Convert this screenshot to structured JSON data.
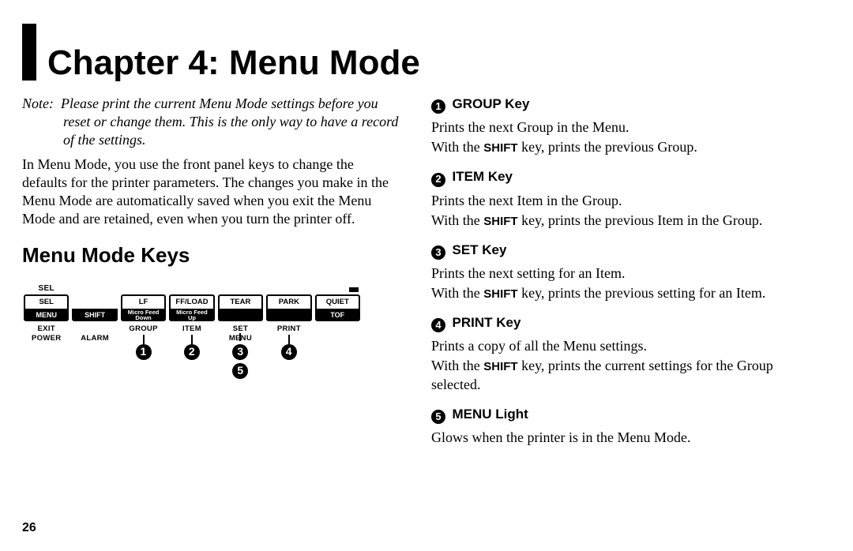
{
  "page_number": "26",
  "title": "Chapter 4: Menu Mode",
  "note_prefix": "Note:",
  "note_body": "Please print the current Menu Mode settings before you reset or change them. This is the only way to have a record of the settings.",
  "intro": "In Menu Mode, you use the front panel keys to change the defaults for the printer parameters. The changes you make in the Menu Mode are automatically saved when you exit the Menu Mode and are retained, even when you turn the printer off.",
  "section_heading": "Menu Mode Keys",
  "panel": {
    "top_left_label": "SEL",
    "keys": [
      {
        "top": "SEL",
        "bottom": "MENU"
      },
      {
        "top": "",
        "bottom": "SHIFT"
      },
      {
        "top": "LF",
        "bottom_line1": "Micro Feed",
        "bottom_line2": "Down"
      },
      {
        "top": "FF/LOAD",
        "bottom_line1": "Micro Feed",
        "bottom_line2": "Up"
      },
      {
        "top": "TEAR",
        "bottom": ""
      },
      {
        "top": "PARK",
        "bottom": ""
      },
      {
        "top": "QUIET",
        "bottom": "TOF"
      }
    ],
    "below_labels_row1": [
      "EXIT",
      "",
      "GROUP",
      "ITEM",
      "SET",
      "PRINT",
      ""
    ],
    "below_labels_row2": [
      "POWER",
      "ALARM",
      "",
      "",
      "MENU",
      "",
      ""
    ],
    "numbers_row": [
      "",
      "",
      "1",
      "2",
      "3",
      "4",
      ""
    ],
    "numbers_row2": [
      "",
      "",
      "",
      "",
      "5",
      "",
      ""
    ]
  },
  "keys_desc": [
    {
      "num": "1",
      "name": "GROUP Key",
      "line1": "Prints the next Group in the Menu.",
      "shift_tail": " key, prints the previous Group."
    },
    {
      "num": "2",
      "name": "ITEM Key",
      "line1": "Prints the next Item in the Group.",
      "shift_tail": " key, prints the previous Item in the Group."
    },
    {
      "num": "3",
      "name": "SET Key",
      "line1": "Prints the next setting for an Item.",
      "shift_tail": " key, prints the previous setting for an Item."
    },
    {
      "num": "4",
      "name": "PRINT Key",
      "line1": "Prints a copy of all the Menu settings.",
      "shift_tail": " key, prints the current settings for the Group selected."
    },
    {
      "num": "5",
      "name": "MENU Light",
      "line1": "Glows when the printer is in the Menu Mode.",
      "shift_tail": ""
    }
  ],
  "shift_prefix": "With the ",
  "shift_word": "SHIFT"
}
